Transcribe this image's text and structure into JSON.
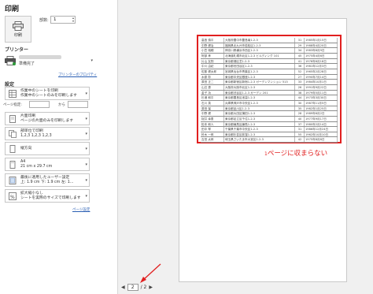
{
  "window": {
    "title": "印刷"
  },
  "print_button": {
    "label": "印刷"
  },
  "copies": {
    "label": "部数:",
    "value": "1"
  },
  "printer": {
    "heading": "プリンター",
    "status": "準備完了",
    "properties_link": "プリンターのプロパティ"
  },
  "settings": {
    "heading": "設定",
    "pages_label": "ページ指定:",
    "to_label": "から",
    "page_setup_link": "ページ設定",
    "dropdowns": [
      {
        "line1": "作業中のシートを印刷",
        "line2": "作業中のシートのみを印刷します",
        "icon": "sheet-icon"
      },
      {
        "line1": "片面印刷",
        "line2": "ページの片面のみを印刷します",
        "icon": "one-sided-icon"
      },
      {
        "line1": "部単位で印刷",
        "line2": "1,2,3    1,2,3    1,2,3",
        "icon": "collate-icon"
      },
      {
        "line1": "縦方向",
        "line2": "",
        "icon": "portrait-icon"
      },
      {
        "line1": "A4",
        "line2": "21 cm x 29.7 cm",
        "icon": "paper-size-icon"
      },
      {
        "line1": "最後に適用したユーザー設定",
        "line2": "上: 1.9 cm 下: 1.9 cm 左: 1...",
        "icon": "margins-icon"
      },
      {
        "line1": "拡大縮小なし",
        "line2": "シートを実際のサイズで印刷します",
        "icon": "scaling-icon"
      }
    ]
  },
  "preview": {
    "annotation": "ページに収まらない",
    "annotation_number": "1",
    "rows": [
      [
        "高島 慎平",
        "大阪府豊中市豊島南1-2-3",
        "31",
        "1985年1月15日"
      ],
      [
        "中野 健治",
        "福岡県北九州市若松区1-2-3",
        "29",
        "1988年4月20日"
      ],
      [
        "小笠 瑞穂",
        "神奈川県横浜市西区1-2-3",
        "34",
        "1983年8月9日"
      ],
      [
        "阿部 孝",
        "北海道札幌市北区1-2-3 ビルディング 101",
        "45",
        "1975年4月6日"
      ],
      [
        "片山 友則",
        "東京都港区芝1-2-3",
        "41",
        "1976年6月18日"
      ],
      [
        "中川 由紀",
        "東京都世田谷区1-2-3",
        "36",
        "1981年12月3日"
      ],
      [
        "佐藤 健太郎",
        "宮城県仙台市青葉区1-2-3",
        "52",
        "1965年2月28日"
      ],
      [
        "木原 彰",
        "東京都中央区銀座1-2-3",
        "27",
        "1990年7月14日"
      ],
      [
        "原田 正二",
        "東京都新宿区新宿1-2-3 ガーデンマンション 513",
        "33",
        "1984年10月1日"
      ],
      [
        "山辺 恵",
        "大阪府大阪市北区1-2-3",
        "26",
        "1991年9月22日"
      ],
      [
        "金子 功",
        "東京都渋谷区1-2-3 ガーデン 201",
        "38",
        "1979年5月11日"
      ],
      [
        "杉浦 和平",
        "東京都豊島区池袋1-2-3",
        "44",
        "1973年3月30日"
      ],
      [
        "石川 英",
        "兵庫県神戸市中央区1-2-3",
        "30",
        "1987年11月5日"
      ],
      [
        "原田 保",
        "東京都品川区1-2-3",
        "35",
        "1982年1月25日"
      ],
      [
        "中野 健",
        "東京都大田区蒲田1-2-3",
        "28",
        "1989年6月2日"
      ],
      [
        "桜井 幸恵",
        "東京都足立区千住1-2-3",
        "40",
        "1977年9月17日"
      ],
      [
        "松本 和人",
        "東京都練馬区練馬1-2-3",
        "37",
        "1980年2月14日"
      ],
      [
        "田中 琴",
        "千葉県千葉市中央区1-2-3",
        "31",
        "1986年12月24日"
      ],
      [
        "鈴木 一郎",
        "東京都杉並区荻窪1-2-3",
        "55",
        "1962年10月10日"
      ],
      [
        "吉田 太郎",
        "埼玉県さいたま市大宮区1-2-3",
        "42",
        "1975年8月8日"
      ]
    ]
  },
  "navigation": {
    "current_page": "2",
    "total": "/ 2"
  },
  "colors": {
    "accent_red": "#e11f1f",
    "link_blue": "#2b5fb3"
  }
}
